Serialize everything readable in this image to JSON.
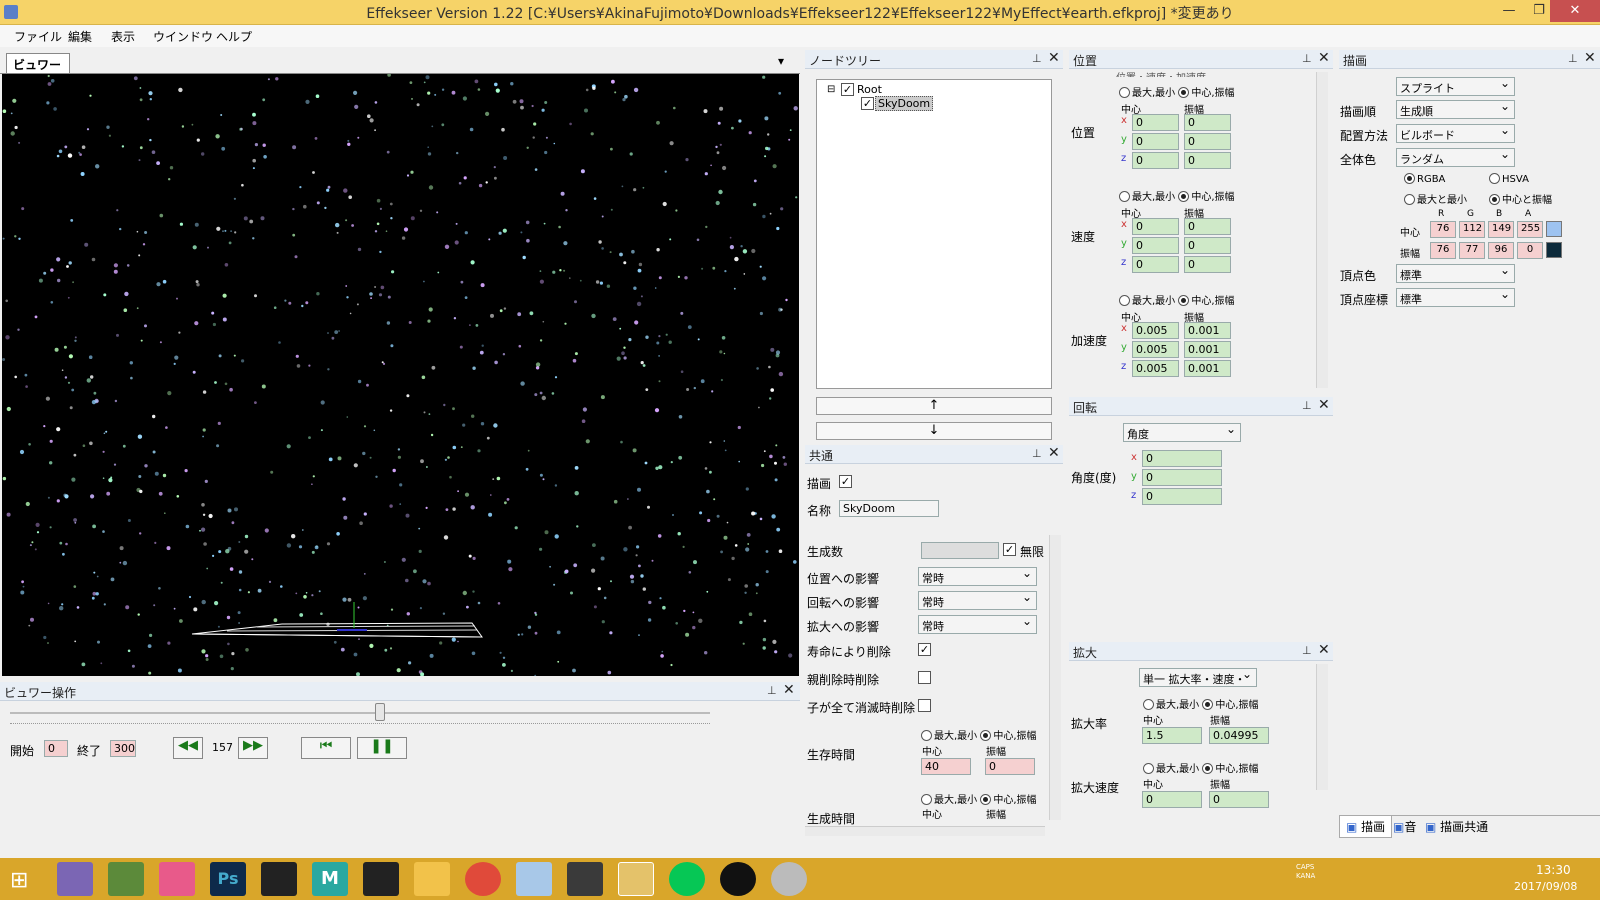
{
  "window": {
    "title": "Effekseer Version 1.22 [C:¥Users¥AkinaFujimoto¥Downloads¥Effekseer122¥Effekseer122¥MyEffect¥earth.efkproj]  *変更あり"
  },
  "menu": [
    "ファイル",
    "編集",
    "表示",
    "ウインドウ",
    "ヘルプ"
  ],
  "viewer": {
    "tab": "ビュワー",
    "ops_title": "ビュワー操作",
    "start_label": "開始",
    "start": "0",
    "end_label": "終了",
    "end": "300",
    "frame": "157"
  },
  "nodetree": {
    "title": "ノードツリー",
    "root": "Root",
    "child": "SkyDoom",
    "up": "↑",
    "down": "↓"
  },
  "common": {
    "title": "共通",
    "draw_label": "描画",
    "name_label": "名称",
    "name": "SkyDoom",
    "count_label": "生成数",
    "infinite": "無限",
    "pos_infl": "位置への影響",
    "rot_infl": "回転への影響",
    "scale_infl": "拡大への影響",
    "always": "常時",
    "del_life": "寿命により削除",
    "del_parent": "親削除時削除",
    "del_children": "子が全て消滅時削除",
    "life_label": "生存時間",
    "life_center": "40",
    "life_amp": "0",
    "gen_label": "生成時間",
    "minmax": "最大,最小",
    "centeramp": "中心,振幅",
    "center": "中心",
    "amp": "振幅"
  },
  "position": {
    "title": "位置",
    "dropdown": "位置・速度・加速度",
    "minmax": "最大,最小",
    "centeramp": "中心,振幅",
    "center": "中心",
    "amp": "振幅",
    "pos_label": "位置",
    "pos": [
      [
        "0",
        "0"
      ],
      [
        "0",
        "0"
      ],
      [
        "0",
        "0"
      ]
    ],
    "vel_label": "速度",
    "vel": [
      [
        "0",
        "0"
      ],
      [
        "0",
        "0"
      ],
      [
        "0",
        "0"
      ]
    ],
    "acc_label": "加速度",
    "acc": [
      [
        "0.005",
        "0.001"
      ],
      [
        "0.005",
        "0.001"
      ],
      [
        "0.005",
        "0.001"
      ]
    ]
  },
  "rotation": {
    "title": "回転",
    "mode": "角度",
    "label": "角度(度)",
    "values": [
      "0",
      "0",
      "0"
    ]
  },
  "scale": {
    "title": "拡大",
    "mode": "単一 拡大率・速度・",
    "rate_label": "拡大率",
    "rate_center": "1.5",
    "rate_amp": "0.04995",
    "speed_label": "拡大速度",
    "speed_center": "0",
    "speed_amp": "0",
    "minmax": "最大,最小",
    "centeramp": "中心,振幅",
    "center": "中心",
    "amp": "振幅"
  },
  "render": {
    "title": "描画",
    "type": "スプライト",
    "order_label": "描画順",
    "order": "生成順",
    "place_label": "配置方法",
    "place": "ビルボード",
    "color_label": "全体色",
    "color": "ランダム",
    "rgba": "RGBA",
    "hsva": "HSVA",
    "maxmin": "最大と最小",
    "centeramp": "中心と振幅",
    "channels": [
      "R",
      "G",
      "B",
      "A"
    ],
    "center_label": "中心",
    "center_vals": [
      "76",
      "112",
      "149",
      "255"
    ],
    "amp_label": "振幅",
    "amp_vals": [
      "76",
      "77",
      "96",
      "0"
    ],
    "vcolor_label": "頂点色",
    "vcolor": "標準",
    "vpos_label": "頂点座標",
    "vpos": "標準",
    "tabs": [
      "描画",
      "音",
      "描画共通"
    ]
  },
  "axes": [
    "x",
    "y",
    "z"
  ],
  "clock": {
    "time": "13:30",
    "date": "2017/09/08"
  },
  "tray": {
    "caps": "CAPS",
    "kana": "KANA"
  },
  "colors": {
    "titlebar": "#f6d368",
    "taskbar": "#d9a62a",
    "swatch_center": "#9ec3f0",
    "swatch_amp": "#0c2a3a"
  }
}
